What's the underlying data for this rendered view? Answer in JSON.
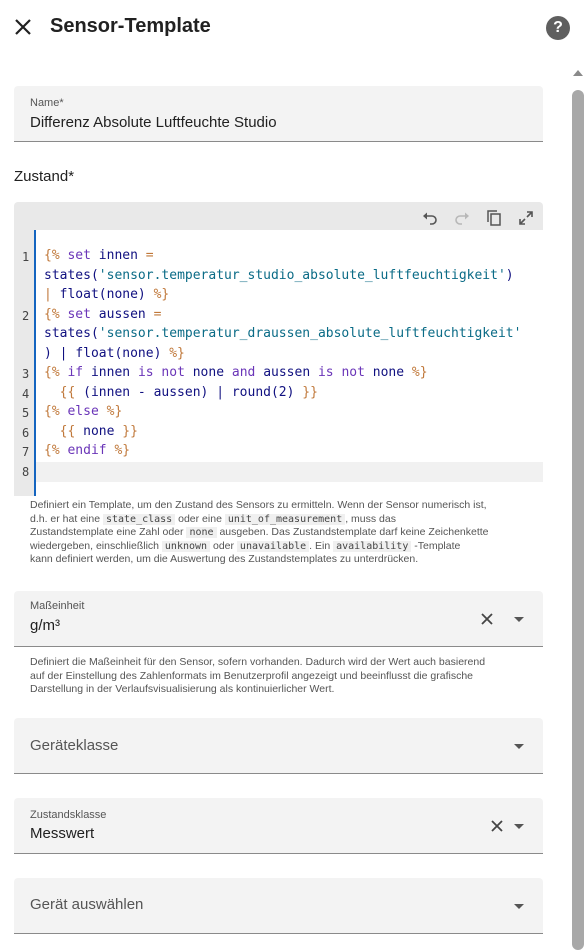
{
  "header": {
    "title": "Sensor-Template"
  },
  "name_field": {
    "label": "Name*",
    "value": "Differenz Absolute Luftfeuchte Studio"
  },
  "state_section": {
    "label": "Zustand*"
  },
  "editor": {
    "line_numbers": [
      "1",
      "2",
      "3",
      "4",
      "5",
      "6",
      "7",
      "8"
    ],
    "lines": [
      [
        {
          "t": "{% ",
          "c": "tag"
        },
        {
          "t": "set ",
          "c": "kw"
        },
        {
          "t": "innen ",
          "c": "var"
        },
        {
          "t": "=",
          "c": "tag"
        }
      ],
      [
        {
          "t": "states(",
          "c": "fn"
        },
        {
          "t": "'sensor.temperatur_studio_absolute_luftfeuchtigkeit'",
          "c": "str"
        },
        {
          "t": ")",
          "c": "fn"
        }
      ],
      [
        {
          "t": "| ",
          "c": "pipe"
        },
        {
          "t": "float(none) ",
          "c": "fn"
        },
        {
          "t": "%}",
          "c": "tag"
        }
      ],
      [
        {
          "t": "{% ",
          "c": "tag"
        },
        {
          "t": "set ",
          "c": "kw"
        },
        {
          "t": "aussen ",
          "c": "var"
        },
        {
          "t": "=",
          "c": "tag"
        }
      ],
      [
        {
          "t": "states(",
          "c": "fn"
        },
        {
          "t": "'sensor.temperatur_draussen_absolute_luftfeuchtigkeit'",
          "c": "str"
        }
      ],
      [
        {
          "t": ") | ",
          "c": "fn"
        },
        {
          "t": "float(none) ",
          "c": "fn"
        },
        {
          "t": "%}",
          "c": "tag"
        }
      ],
      [
        {
          "t": "{% ",
          "c": "tag"
        },
        {
          "t": "if ",
          "c": "kw"
        },
        {
          "t": "innen ",
          "c": "var"
        },
        {
          "t": "is ",
          "c": "kw"
        },
        {
          "t": "not ",
          "c": "kw"
        },
        {
          "t": "none ",
          "c": "var"
        },
        {
          "t": "and ",
          "c": "kw"
        },
        {
          "t": "aussen ",
          "c": "var"
        },
        {
          "t": "is ",
          "c": "kw"
        },
        {
          "t": "not ",
          "c": "kw"
        },
        {
          "t": "none ",
          "c": "var"
        },
        {
          "t": "%}",
          "c": "tag"
        }
      ],
      [
        {
          "t": "  {{ ",
          "c": "tag"
        },
        {
          "t": "(innen - aussen) | round(2) ",
          "c": "var"
        },
        {
          "t": "}}",
          "c": "tag"
        }
      ],
      [
        {
          "t": "{% ",
          "c": "tag"
        },
        {
          "t": "else ",
          "c": "kw"
        },
        {
          "t": "%}",
          "c": "tag"
        }
      ],
      [
        {
          "t": "  {{ ",
          "c": "tag"
        },
        {
          "t": "none ",
          "c": "var"
        },
        {
          "t": "}}",
          "c": "tag"
        }
      ],
      [
        {
          "t": "{% ",
          "c": "tag"
        },
        {
          "t": "endif ",
          "c": "kw"
        },
        {
          "t": "%}",
          "c": "tag"
        }
      ],
      []
    ]
  },
  "state_help": {
    "p1": "Definiert ein Template, um den Zustand des Sensors zu ermitteln. Wenn der Sensor numerisch ist,",
    "p2a": "d.h. er hat eine ",
    "c1": "state_class",
    "p2b": " oder eine ",
    "c2": "unit_of_measurement",
    "p2c": ", muss das",
    "p3a": "Zustandstemplate eine Zahl oder ",
    "c3": "none",
    "p3b": " ausgeben. Das Zustandstemplate darf keine Zeichenkette",
    "p4a": "wiedergeben, einschließlich ",
    "c4": "unknown",
    "p4b": " oder ",
    "c5": "unavailable",
    "p4c": ". Ein ",
    "c6": "availability",
    "p4d": " -Template",
    "p5": "kann definiert werden, um die Auswertung des Zustandstemplates zu unterdrücken."
  },
  "unit_field": {
    "label": "Maßeinheit",
    "value": "g/m³"
  },
  "unit_help": {
    "l1": "Definiert die Maßeinheit für den Sensor, sofern vorhanden. Dadurch wird der Wert auch basierend",
    "l2": "auf der Einstellung des Zahlenformats im Benutzerprofil angezeigt und beeinflusst die grafische",
    "l3": "Darstellung in der Verlaufsvisualisierung als kontinuierlicher Wert."
  },
  "device_class_field": {
    "placeholder": "Geräteklasse"
  },
  "state_class_field": {
    "label": "Zustandsklasse",
    "value": "Messwert"
  },
  "device_field": {
    "placeholder": "Gerät auswählen"
  },
  "icons": [
    "close-icon",
    "help-icon",
    "undo-icon",
    "redo-icon",
    "copy-icon",
    "fullscreen-icon",
    "clear-icon",
    "chevron-down-icon"
  ]
}
